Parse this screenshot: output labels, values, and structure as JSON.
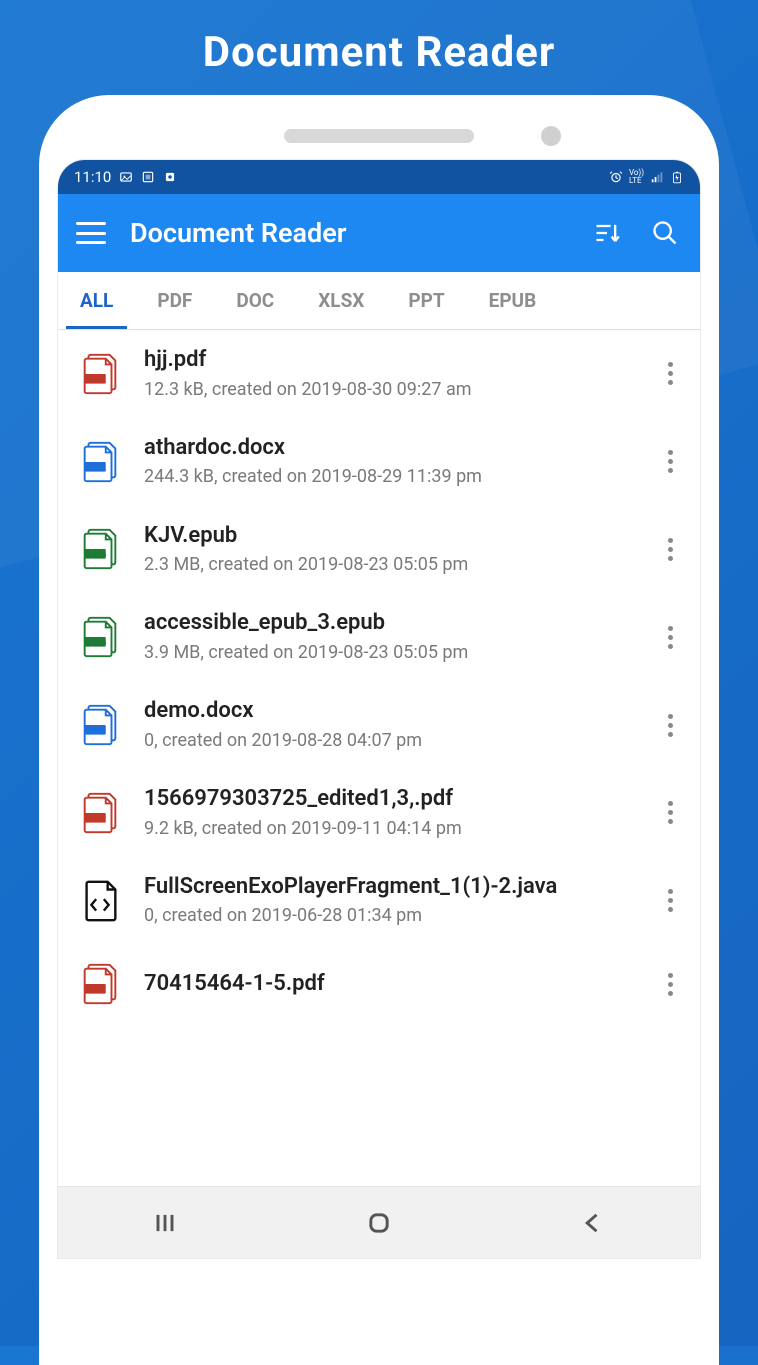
{
  "promo": {
    "title": "Document  Reader"
  },
  "statusbar": {
    "time": "11:10"
  },
  "appbar": {
    "title": "Document Reader"
  },
  "tabs": [
    {
      "label": "ALL",
      "active": true
    },
    {
      "label": "PDF",
      "active": false
    },
    {
      "label": "DOC",
      "active": false
    },
    {
      "label": "XLSX",
      "active": false
    },
    {
      "label": "PPT",
      "active": false
    },
    {
      "label": "EPUB",
      "active": false
    }
  ],
  "files": [
    {
      "name": "hjj.pdf",
      "meta": "12.3 kB, created on  2019-08-30 09:27 am",
      "type": "pdf"
    },
    {
      "name": "athardoc.docx",
      "meta": "244.3 kB, created on  2019-08-29 11:39 pm",
      "type": "doc"
    },
    {
      "name": "KJV.epub",
      "meta": "2.3 MB, created on  2019-08-23 05:05 pm",
      "type": "epub"
    },
    {
      "name": "accessible_epub_3.epub",
      "meta": "3.9 MB, created on  2019-08-23 05:05 pm",
      "type": "epub"
    },
    {
      "name": "demo.docx",
      "meta": "0, created on  2019-08-28 04:07 pm",
      "type": "doc"
    },
    {
      "name": "1566979303725_edited1,3,.pdf",
      "meta": "9.2 kB, created on  2019-09-11 04:14 pm",
      "type": "pdf"
    },
    {
      "name": "FullScreenExoPlayerFragment_1(1)-2.java",
      "meta": "0, created on  2019-06-28 01:34 pm",
      "type": "code"
    },
    {
      "name": "70415464-1-5.pdf",
      "meta": "",
      "type": "pdf"
    }
  ]
}
